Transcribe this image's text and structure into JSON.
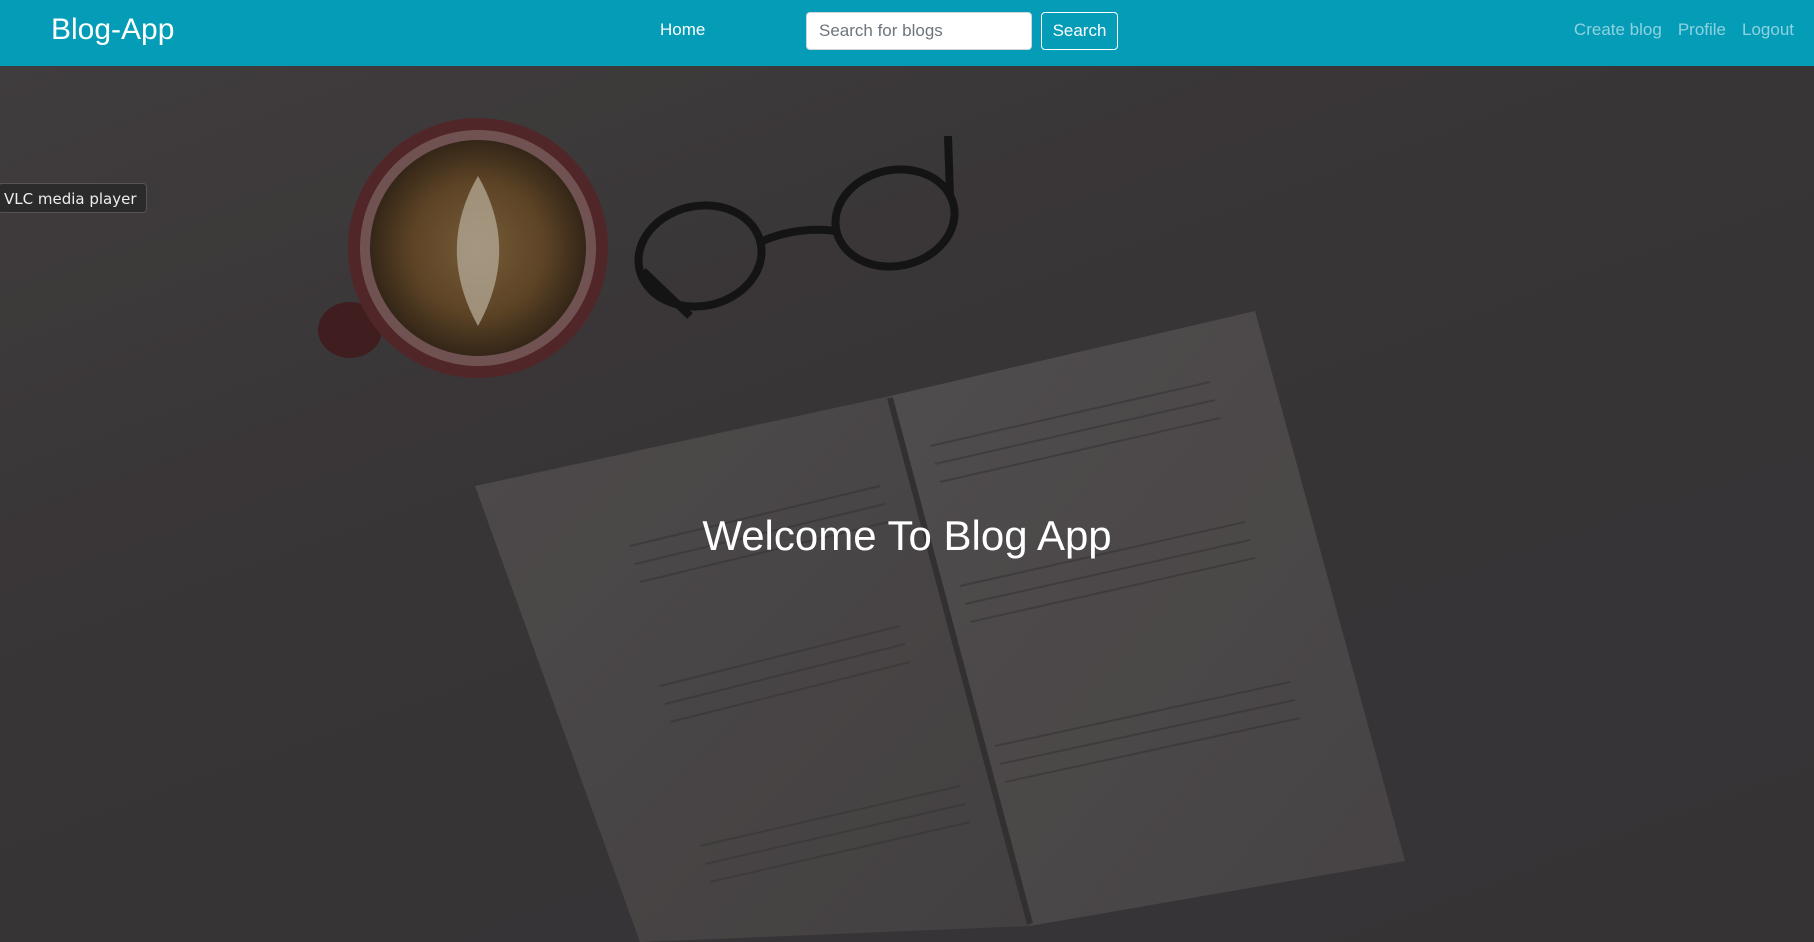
{
  "navbar": {
    "brand": "Blog-App",
    "home_label": "Home",
    "search_placeholder": "Search for blogs",
    "search_button_label": "Search",
    "right_links": [
      "Create blog",
      "Profile",
      "Logout"
    ],
    "background_color": "#049cb7"
  },
  "hero": {
    "title": "Welcome To Blog App"
  },
  "tooltip": {
    "text": "VLC media player"
  }
}
